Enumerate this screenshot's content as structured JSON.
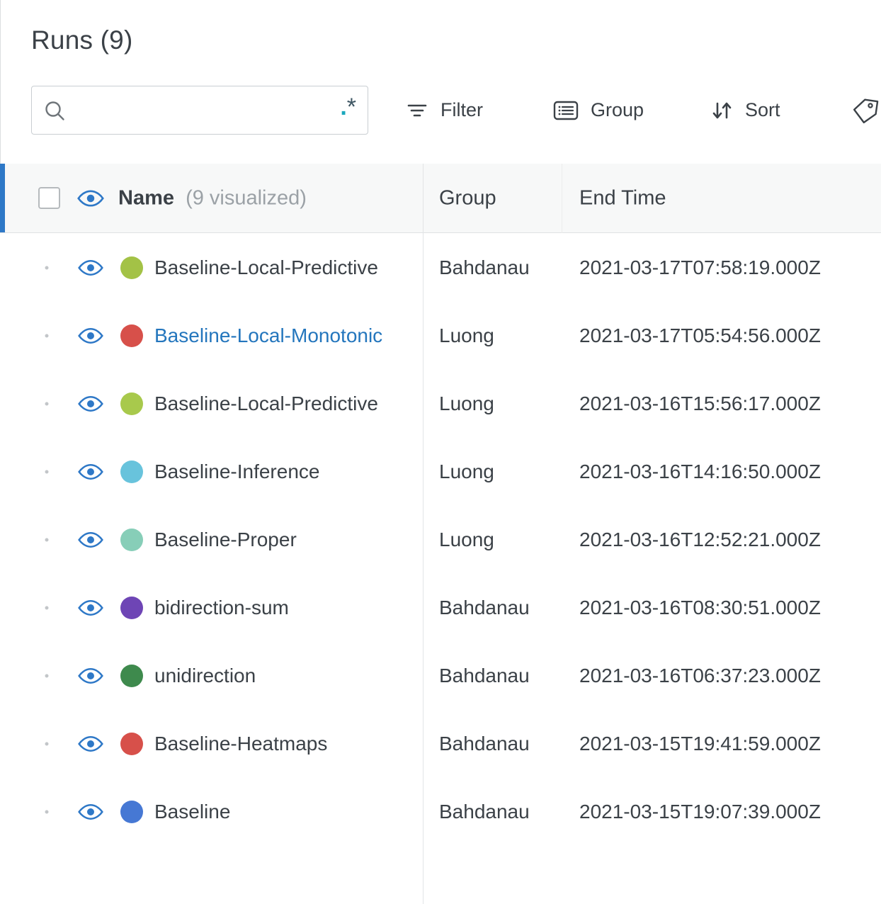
{
  "page": {
    "title": "Runs (9)"
  },
  "search": {
    "value": "",
    "placeholder": "",
    "regex_dot": ".",
    "regex_star": "*"
  },
  "toolbar": {
    "filter": "Filter",
    "group": "Group",
    "sort": "Sort"
  },
  "table": {
    "header": {
      "name": "Name",
      "visualized": "(9 visualized)",
      "group": "Group",
      "end_time": "End Time"
    },
    "rows": [
      {
        "name": "Baseline-Local-Predictive",
        "dot_color": "#a3c246",
        "group": "Bahdanau",
        "end_time": "2021-03-17T07:58:19.000Z",
        "highlighted": false
      },
      {
        "name": "Baseline-Local-Monotonic",
        "dot_color": "#d7504a",
        "group": "Luong",
        "end_time": "2021-03-17T05:54:56.000Z",
        "highlighted": true
      },
      {
        "name": "Baseline-Local-Predictive",
        "dot_color": "#a8c94c",
        "group": "Luong",
        "end_time": "2021-03-16T15:56:17.000Z",
        "highlighted": false
      },
      {
        "name": "Baseline-Inference",
        "dot_color": "#68c3dc",
        "group": "Luong",
        "end_time": "2021-03-16T14:16:50.000Z",
        "highlighted": false
      },
      {
        "name": "Baseline-Proper",
        "dot_color": "#87ceb8",
        "group": "Luong",
        "end_time": "2021-03-16T12:52:21.000Z",
        "highlighted": false
      },
      {
        "name": "bidirection-sum",
        "dot_color": "#6e45b5",
        "group": "Bahdanau",
        "end_time": "2021-03-16T08:30:51.000Z",
        "highlighted": false
      },
      {
        "name": "unidirection",
        "dot_color": "#3e8a4d",
        "group": "Bahdanau",
        "end_time": "2021-03-16T06:37:23.000Z",
        "highlighted": false
      },
      {
        "name": "Baseline-Heatmaps",
        "dot_color": "#d7504a",
        "group": "Bahdanau",
        "end_time": "2021-03-15T19:41:59.000Z",
        "highlighted": false
      },
      {
        "name": "Baseline",
        "dot_color": "#4678d4",
        "group": "Bahdanau",
        "end_time": "2021-03-15T19:07:39.000Z",
        "highlighted": false
      }
    ]
  },
  "colors": {
    "accent_blue": "#2e78c7",
    "link_blue": "#2476bd",
    "regex_teal": "#1ba8bd",
    "header_bg": "#f7f8f8"
  }
}
